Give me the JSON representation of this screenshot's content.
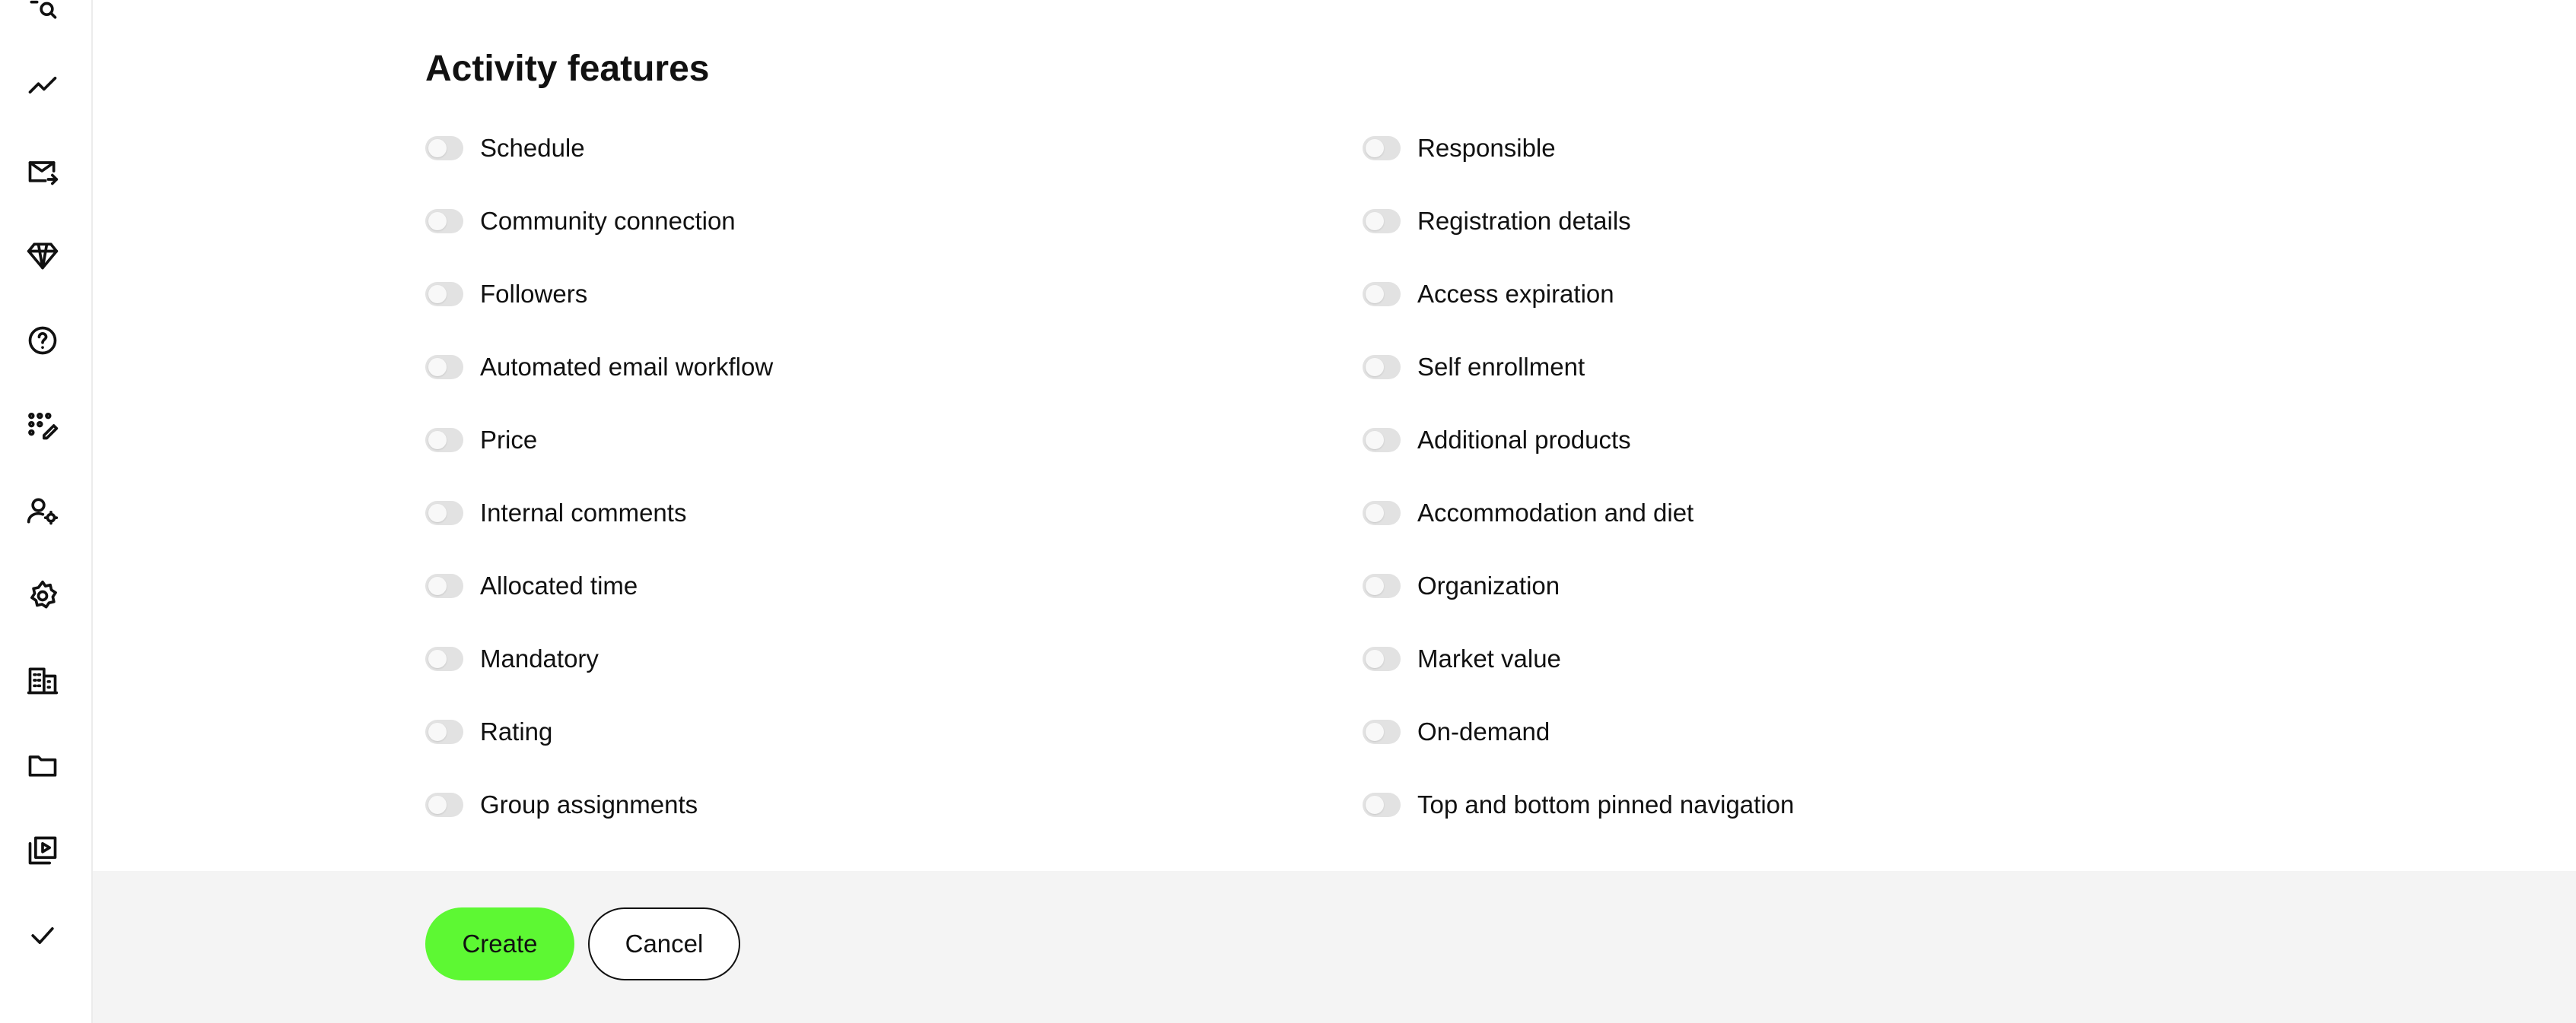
{
  "sidebar": {
    "icons": [
      {
        "name": "search-icon"
      },
      {
        "name": "analytics-icon"
      },
      {
        "name": "mail-send-icon"
      },
      {
        "name": "diamond-icon"
      },
      {
        "name": "help-icon"
      },
      {
        "name": "edit-grid-icon"
      },
      {
        "name": "user-settings-icon"
      },
      {
        "name": "gear-icon"
      },
      {
        "name": "building-icon"
      },
      {
        "name": "folder-icon"
      },
      {
        "name": "video-library-icon"
      },
      {
        "name": "check-icon"
      }
    ]
  },
  "section": {
    "title": "Activity features"
  },
  "features": {
    "left": [
      {
        "label": "Schedule",
        "enabled": false
      },
      {
        "label": "Community connection",
        "enabled": false
      },
      {
        "label": "Followers",
        "enabled": false
      },
      {
        "label": "Automated email workflow",
        "enabled": false
      },
      {
        "label": "Price",
        "enabled": false
      },
      {
        "label": "Internal comments",
        "enabled": false
      },
      {
        "label": "Allocated time",
        "enabled": false
      },
      {
        "label": "Mandatory",
        "enabled": false
      },
      {
        "label": "Rating",
        "enabled": false
      },
      {
        "label": "Group assignments",
        "enabled": false
      }
    ],
    "right": [
      {
        "label": "Responsible",
        "enabled": false
      },
      {
        "label": "Registration details",
        "enabled": false
      },
      {
        "label": "Access expiration",
        "enabled": false
      },
      {
        "label": "Self enrollment",
        "enabled": false
      },
      {
        "label": "Additional products",
        "enabled": false
      },
      {
        "label": "Accommodation and diet",
        "enabled": false
      },
      {
        "label": "Organization",
        "enabled": false
      },
      {
        "label": "Market value",
        "enabled": false
      },
      {
        "label": "On-demand",
        "enabled": false
      },
      {
        "label": "Top and bottom pinned navigation",
        "enabled": false
      }
    ]
  },
  "footer": {
    "create_label": "Create",
    "cancel_label": "Cancel"
  },
  "colors": {
    "accent": "#5df833",
    "toggle_off": "#e2e2e2",
    "footer_bg": "#f4f4f4"
  }
}
